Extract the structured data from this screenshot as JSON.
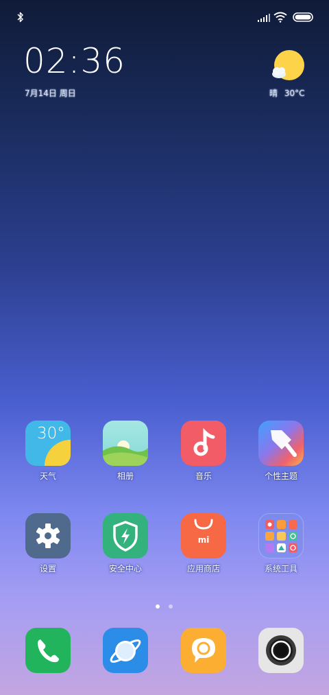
{
  "status_bar": {
    "icons": [
      "bluetooth-icon",
      "signal-icon",
      "wifi-icon",
      "battery-icon"
    ]
  },
  "clock": {
    "time": "02:36",
    "date": "7月14日 周日"
  },
  "weather_widget": {
    "condition": "晴",
    "temperature": "30°C",
    "icon": "sun-cloud-icon"
  },
  "apps": {
    "row1": [
      {
        "label": "天气",
        "icon": "weather-icon",
        "icon_text": "30°"
      },
      {
        "label": "相册",
        "icon": "gallery-icon"
      },
      {
        "label": "音乐",
        "icon": "music-icon"
      },
      {
        "label": "个性主题",
        "icon": "themes-icon"
      }
    ],
    "row2": [
      {
        "label": "设置",
        "icon": "gear-icon"
      },
      {
        "label": "安全中心",
        "icon": "shield-icon"
      },
      {
        "label": "应用商店",
        "icon": "store-bag-icon",
        "icon_text": "mi"
      },
      {
        "label": "系统工具",
        "icon": "folder-icon"
      }
    ]
  },
  "page_indicator": {
    "current_page": 1,
    "total_pages": 2
  },
  "dock": [
    {
      "icon": "phone-icon"
    },
    {
      "icon": "browser-icon"
    },
    {
      "icon": "messages-icon"
    },
    {
      "icon": "camera-icon"
    }
  ],
  "colors": {
    "weather_bg": "#41b8e8",
    "gallery_bg": "#9be3df",
    "music_bg": "#f25c66",
    "settings_bg": "#4f6a8c",
    "security_bg": "#34b27d",
    "store_bg": "#f76944",
    "phone_bg": "#21b45d",
    "browser_bg": "#2b8de8",
    "messages_bg": "#fcae33",
    "camera_bg": "#e6e6e6"
  }
}
